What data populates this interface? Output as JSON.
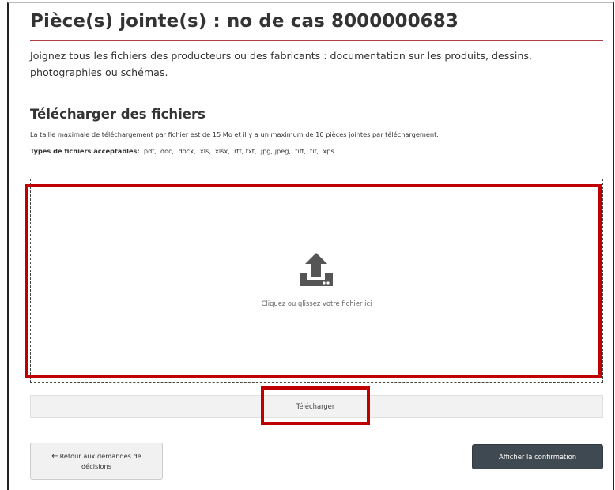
{
  "page": {
    "title": "Pièce(s) jointe(s) : no de cas 8000000683",
    "intro": "Joignez tous les fichiers des producteurs ou des fabricants : documentation sur les produits, dessins, photographies ou schémas."
  },
  "upload_section": {
    "heading": "Télécharger des fichiers",
    "limit_text": "La taille maximale de téléchargement par fichier est de 15 Mo et il y a un maximum de 10 pièces jointes par téléchargement.",
    "types_label": "Types de fichiers acceptables:",
    "types_value": " .pdf, .doc, .docx, .xls, .xlsx, .rtf, txt, .jpg, jpeg, .tiff, .tif, .xps"
  },
  "dropzone": {
    "icon": "upload-icon",
    "label": "Cliquez ou glissez votre fichier ici"
  },
  "actions": {
    "upload_label": "Télécharger",
    "back_arrow": "←",
    "back_label": "Retour aux demandes de décisions",
    "confirm_label": "Afficher la confirmation"
  },
  "colors": {
    "highlight": "#c00000",
    "title_rule": "#af3c43",
    "primary_button": "#3f4952",
    "icon": "#555555"
  }
}
